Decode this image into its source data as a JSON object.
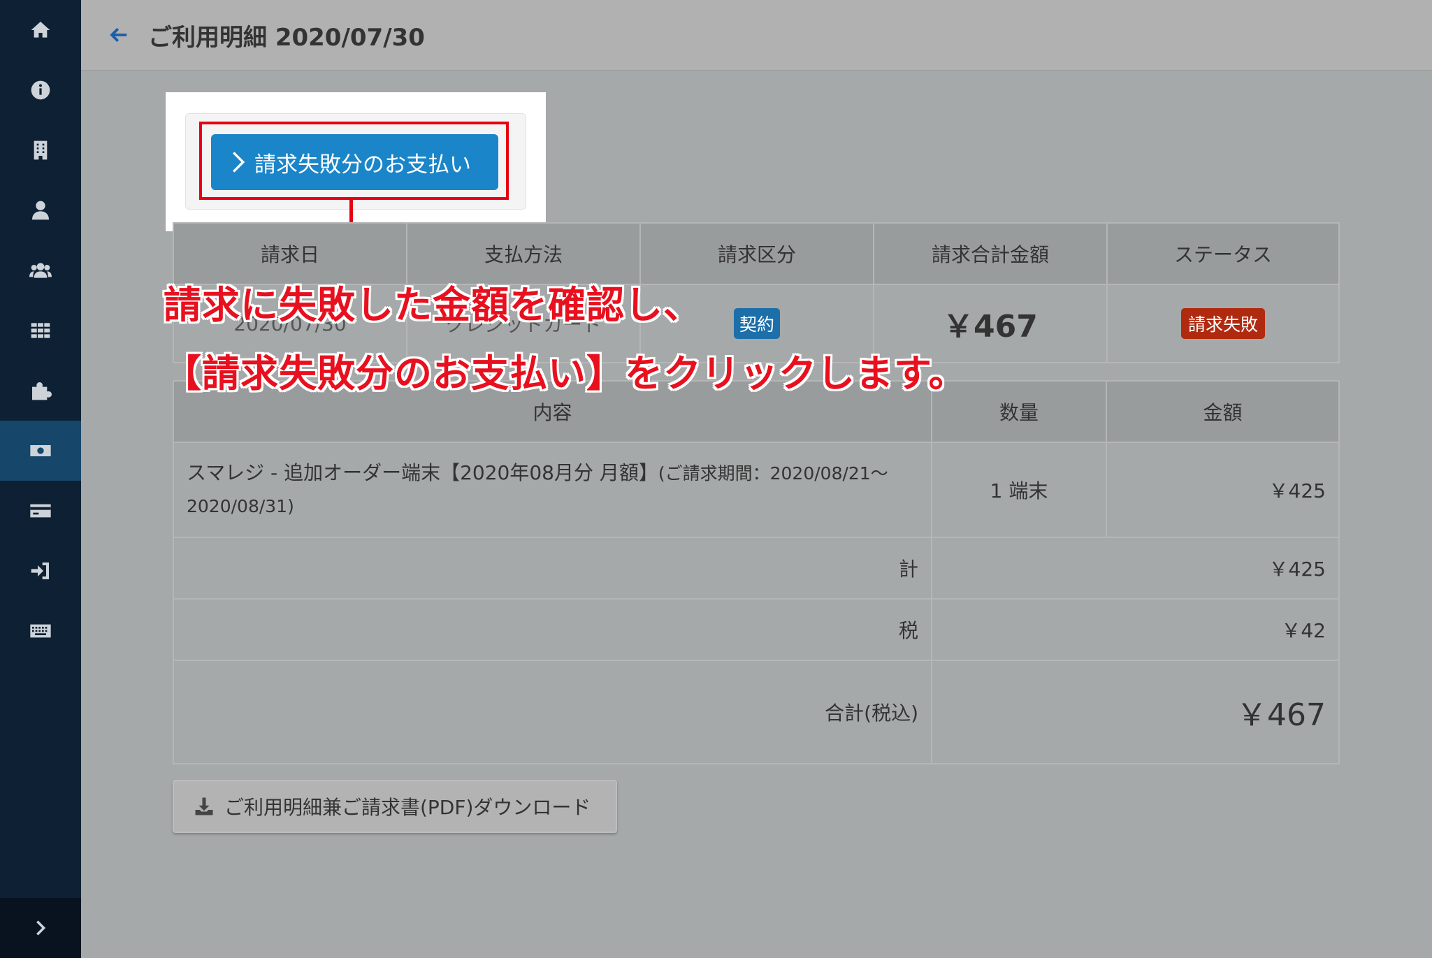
{
  "header": {
    "title": "ご利用明細 2020/07/30"
  },
  "sidebar": {
    "items": [
      {
        "icon": "home-icon"
      },
      {
        "icon": "info-icon"
      },
      {
        "icon": "building-icon"
      },
      {
        "icon": "user-icon"
      },
      {
        "icon": "users-icon"
      },
      {
        "icon": "apps-grid-icon"
      },
      {
        "icon": "puzzle-icon"
      },
      {
        "icon": "money-bill-icon",
        "active": true
      },
      {
        "icon": "credit-card-icon"
      },
      {
        "icon": "sign-in-icon"
      },
      {
        "icon": "keyboard-icon"
      }
    ],
    "expand_icon": "chevron-right-icon"
  },
  "action": {
    "pay_failed_label": "請求失敗分のお支払い"
  },
  "summary": {
    "headers": [
      "請求日",
      "支払方法",
      "請求区分",
      "請求合計金額",
      "ステータス"
    ],
    "row": {
      "date": "2020/07/30",
      "payment_method": "クレジットカード",
      "category": "契約",
      "total": "￥467",
      "status": "請求失敗"
    }
  },
  "detail": {
    "headers": [
      "内容",
      "数量",
      "金額"
    ],
    "item": {
      "desc_main": "スマレジ - 追加オーダー端末【2020年08月分 月額】",
      "desc_small": "(ご請求期間：2020/08/21～",
      "desc_line2": "2020/08/31)",
      "qty": "1 端末",
      "amount": "￥425"
    },
    "subtotal_label": "計",
    "subtotal": "￥425",
    "tax_label": "税",
    "tax": "￥42",
    "grand_label": "合計(税込)",
    "grand_total": "￥467"
  },
  "download": {
    "label": "ご利用明細兼ご請求書(PDF)ダウンロード"
  },
  "annotation": {
    "line1": "請求に失敗した金額を確認し、",
    "line2": "【請求失敗分のお支払い】をクリックします。"
  },
  "colors": {
    "sidebar": "#0e2033",
    "sidebar_active": "#16466a",
    "primary_button": "#1a85c9",
    "highlight_red": "#e60012",
    "badge_contract": "#1c6fa9",
    "badge_failed": "#b02a10"
  }
}
